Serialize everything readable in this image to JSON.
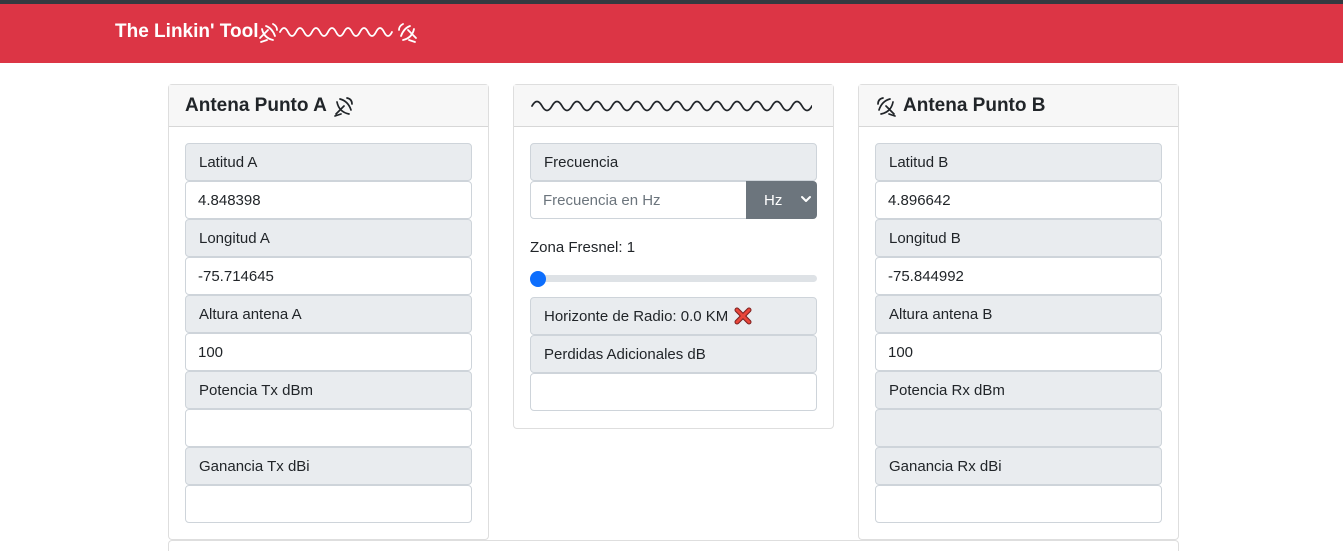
{
  "app": {
    "title": "The Linkin' Tool"
  },
  "colors": {
    "navbar": "#dc3545",
    "accent": "#0d6efd",
    "select_bg": "#6c757d"
  },
  "panel_a": {
    "title": "Antena Punto A",
    "title_icon": "satellite-dish-icon",
    "lat_label": "Latitud A",
    "lat_value": "4.848398",
    "lon_label": "Longitud A",
    "lon_value": "-75.714645",
    "height_label": "Altura antena A",
    "height_value": "100",
    "power_label": "Potencia Tx dBm",
    "power_value": "",
    "gain_label": "Ganancia Tx dBi",
    "gain_value": ""
  },
  "panel_center": {
    "header_icon": "wave-link-icon",
    "freq_label": "Frecuencia",
    "freq_placeholder": "Frecuencia en Hz",
    "freq_unit": "Hz",
    "fresnel_label": "Zona Fresnel: 1",
    "fresnel_value": 1,
    "radio_horizon_label": "Horizonte de Radio: 0.0 KM",
    "radio_horizon_status_icon": "cross-mark-icon",
    "losses_label": "Perdidas Adicionales dB",
    "losses_value": ""
  },
  "panel_b": {
    "title": "Antena Punto B",
    "title_icon": "satellite-dish-icon",
    "lat_label": "Latitud B",
    "lat_value": "4.896642",
    "lon_label": "Longitud B",
    "lon_value": "-75.844992",
    "height_label": "Altura antena B",
    "height_value": "100",
    "power_label": "Potencia Rx dBm",
    "power_value": "",
    "gain_label": "Ganancia Rx dBi",
    "gain_value": ""
  }
}
